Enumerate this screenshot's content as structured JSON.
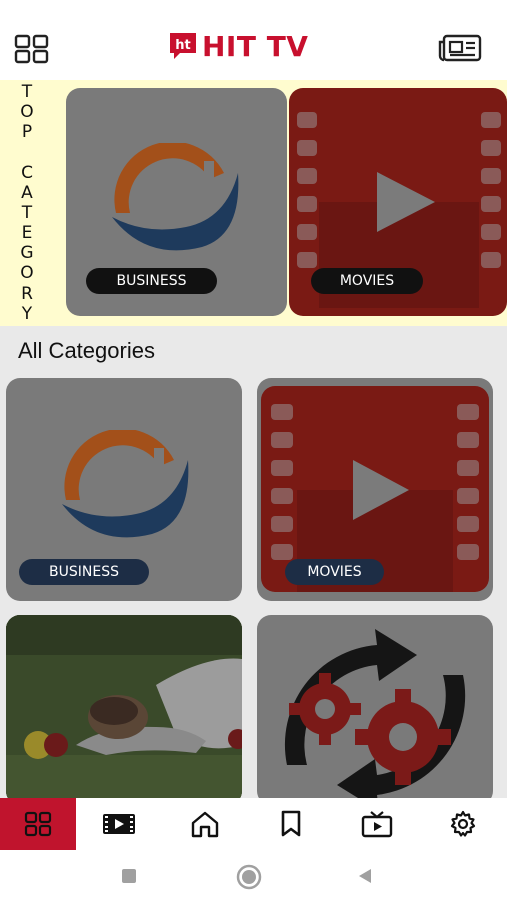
{
  "app": {
    "title": "HIT TV"
  },
  "top_category": {
    "label_letters": [
      "T",
      "O",
      "P",
      "",
      "C",
      "A",
      "T",
      "E",
      "G",
      "O",
      "R",
      "Y"
    ],
    "cards": [
      {
        "label": "BUSINESS",
        "icon": "business-growth-icon"
      },
      {
        "label": "MOVIES",
        "icon": "film-play-icon"
      }
    ]
  },
  "all_categories": {
    "title": "All Categories",
    "cards": [
      {
        "label": "BUSINESS",
        "icon": "business-growth-icon"
      },
      {
        "label": "MOVIES",
        "icon": "film-play-icon"
      },
      {
        "label": "",
        "icon": "sports-photo"
      },
      {
        "label": "",
        "icon": "gears-refresh-icon"
      }
    ]
  },
  "bottom_nav": {
    "items": [
      {
        "name": "categories",
        "icon": "grid-icon",
        "active": true
      },
      {
        "name": "videos",
        "icon": "film-icon",
        "active": false
      },
      {
        "name": "home",
        "icon": "home-icon",
        "active": false
      },
      {
        "name": "bookmarks",
        "icon": "bookmark-icon",
        "active": false
      },
      {
        "name": "live-tv",
        "icon": "tv-play-icon",
        "active": false
      },
      {
        "name": "settings",
        "icon": "gear-icon",
        "active": false
      }
    ]
  },
  "colors": {
    "brand_red": "#c8102e",
    "top_strip_bg": "#fffccf",
    "grid_bg": "#e9e9e9"
  }
}
